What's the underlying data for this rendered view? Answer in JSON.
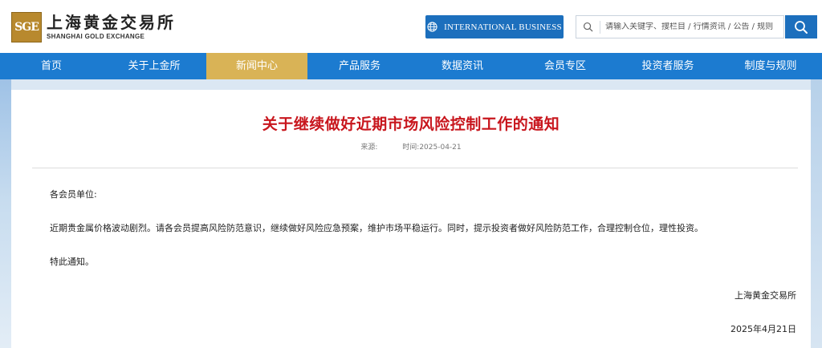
{
  "header": {
    "logo_mark": "SGE",
    "logo_cn": "上海黄金交易所",
    "logo_en": "SHANGHAI GOLD EXCHANGE",
    "intl_button_label": "INTERNATIONAL BUSINESS",
    "search": {
      "placeholder": "请输入关键字、搜栏目 / 行情资讯 / 公告 / 规则"
    }
  },
  "nav": {
    "items": [
      {
        "label": "首页"
      },
      {
        "label": "关于上金所"
      },
      {
        "label": "新闻中心"
      },
      {
        "label": "产品服务"
      },
      {
        "label": "数据资讯"
      },
      {
        "label": "会员专区"
      },
      {
        "label": "投资者服务"
      },
      {
        "label": "制度与规则"
      }
    ],
    "active_index": 2
  },
  "article": {
    "title": "关于继续做好近期市场风险控制工作的通知",
    "source_label": "来源:",
    "time_label": "时间:2025-04-21",
    "greeting": "各会员单位:",
    "body": "近期贵金属价格波动剧烈。请各会员提高风险防范意识，继续做好风险应急预案，维护市场平稳运行。同时，提示投资者做好风险防范工作，合理控制仓位，理性投资。",
    "closing": "特此通知。",
    "signature": "上海黄金交易所",
    "date": "2025年4月21日"
  },
  "colors": {
    "brand_blue": "#1c7bd0",
    "nav_active_gold": "#d9b356",
    "title_red": "#c8161d"
  },
  "icons": {
    "globe": "globe-icon",
    "search": "search-icon"
  }
}
